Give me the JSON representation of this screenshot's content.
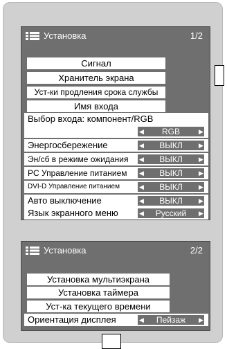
{
  "panel1": {
    "title": "Установка",
    "page": "1/2",
    "buttons": [
      "Сигнал",
      "Хранитель экрана",
      "Уст-ки продления срока службы",
      "Имя входа"
    ],
    "input_select": {
      "label": "Выбор входа: компонент/RGB",
      "value": "RGB"
    },
    "settings": [
      {
        "label": "Энергосбережение",
        "value": "ВЫКЛ"
      },
      {
        "label": "Эн/сб в режиме ожидания",
        "value": "ВЫКЛ"
      },
      {
        "label": "PC Управление питанием",
        "value": "ВЫКЛ"
      },
      {
        "label": "DVI-D Управление питанием",
        "value": "ВЫКЛ"
      },
      {
        "label": "Авто выключение",
        "value": "ВЫКЛ"
      },
      {
        "label": "Язык экранного меню",
        "value": "Русский"
      }
    ]
  },
  "panel2": {
    "title": "Установка",
    "page": "2/2",
    "buttons": [
      "Установка мультиэкрана",
      "Установка таймера",
      "Уст-ка текущего времени"
    ],
    "orientation": {
      "label": "Ориентация дисплея",
      "value": "Пейзаж"
    }
  },
  "colors": {
    "panel": "#6f6f6f",
    "background": "#d0d0d0"
  },
  "icons": [
    "menu-icon",
    "arrow-left-icon",
    "arrow-right-icon"
  ]
}
